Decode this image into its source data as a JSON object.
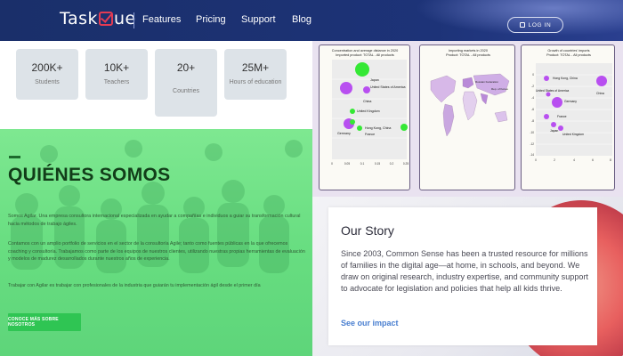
{
  "header": {
    "logo_prefix": "Task",
    "logo_suffix": "ue",
    "nav": [
      "Features",
      "Pricing",
      "Support",
      "Blog"
    ],
    "login_label": "LOG IN",
    "login_icon": "login-icon"
  },
  "stats": [
    {
      "value": "200K+",
      "label": "Students"
    },
    {
      "value": "10K+",
      "label": "Teachers"
    },
    {
      "value": "20+",
      "label": "Countries"
    },
    {
      "value": "25M+",
      "label": "Hours of education"
    }
  ],
  "about": {
    "title": "QUIÉNES SOMOS",
    "paragraphs": [
      "Somos Agilar. Una empresa consultora internacional especializada en ayudar a compañías e individuos a guiar su transformación cultural hacia métodos de trabajo ágiles.",
      "Contamos con un amplio portfolio de servicios en el sector de la consultoría Agile; tanto como fuentes públicas en la que ofrecemos coaching y consultoría. Trabajamos como parte de los equipos de nuestros clientes, utilizando nuestras propias herramientas de evaluación y modelos de madurez desarrollados durante nuestros años de experiencia.",
      "Trabajar con Agilar es trabajar con profesionales de la industria que guiarán tu implementación ágil desde el primer día"
    ],
    "button_label": "CONOCE MÁS SOBRE NOSOTROS"
  },
  "charts_panel": {
    "card1_title": "Concentration and average distance in 2020",
    "card1_subtitle": "Imported product: TOTAL - All products",
    "card2_title": "Importing markets in 2020",
    "card2_subtitle": "Product: TOTAL - All products",
    "card3_title": "Growth of countries' imports",
    "card3_subtitle": "Product: TOTAL - All products",
    "card1_labels": [
      "Japan",
      "United States of America",
      "China",
      "United Kingdom",
      "Germany",
      "Hong Kong, China",
      "France"
    ],
    "card1_xticks": [
      "0",
      "0.05",
      "0.1",
      "0.15",
      "0.2",
      "0.25"
    ],
    "card3_labels": [
      "Hong Kong, China",
      "United States of America",
      "Germany",
      "China",
      "France",
      "Japan",
      "United Kingdom"
    ],
    "card3_yticks": [
      "0",
      "-2",
      "-4",
      "-6",
      "-8",
      "-10",
      "-12",
      "-14"
    ],
    "card3_xticks": [
      "0",
      "2",
      "4",
      "6",
      "8"
    ],
    "map_legend": [
      "Russian Federation",
      "Rep. of Korea"
    ]
  },
  "story": {
    "title": "Our Story",
    "text": "Since 2003, Common Sense has been a trusted resource for millions of families in the digital age—at home, in schools, and beyond. We draw on original research, industry expertise, and community support to advocate for legislation and policies that help all kids thrive.",
    "link_label": "See our impact"
  },
  "colors": {
    "header": "#1d3378",
    "accent_green": "#2fc553",
    "link_blue": "#4a7fd0",
    "bubble_purple": "#b84ff0",
    "bubble_green": "#35e835"
  }
}
